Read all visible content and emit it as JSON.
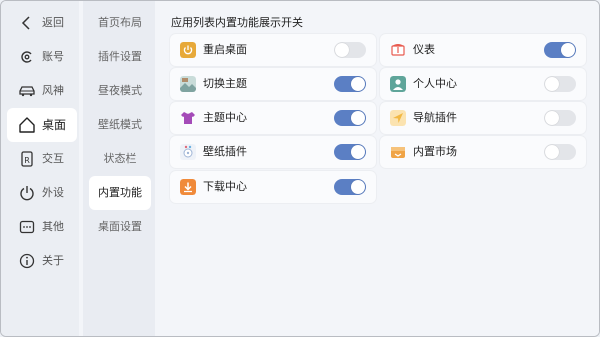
{
  "colors": {
    "toggle_on": "#5b7fc4",
    "toggle_off": "#e3e5e9",
    "active_bg": "#ffffff"
  },
  "nav": {
    "items": [
      {
        "label": "返回",
        "icon": "back-icon",
        "active": false
      },
      {
        "label": "账号",
        "icon": "account-icon",
        "active": false
      },
      {
        "label": "风神",
        "icon": "car-icon",
        "active": false
      },
      {
        "label": "桌面",
        "icon": "home-icon",
        "active": true
      },
      {
        "label": "交互",
        "icon": "interaction-icon",
        "active": false
      },
      {
        "label": "外设",
        "icon": "power-icon",
        "active": false
      },
      {
        "label": "其他",
        "icon": "more-icon",
        "active": false
      },
      {
        "label": "关于",
        "icon": "info-icon",
        "active": false
      }
    ]
  },
  "submenu": {
    "items": [
      {
        "label": "首页布局",
        "active": false
      },
      {
        "label": "插件设置",
        "active": false
      },
      {
        "label": "昼夜模式",
        "active": false
      },
      {
        "label": "壁纸模式",
        "active": false
      },
      {
        "label": "状态栏",
        "active": false
      },
      {
        "label": "内置功能",
        "active": true
      },
      {
        "label": "桌面设置",
        "active": false
      }
    ]
  },
  "main": {
    "title": "应用列表内置功能展示开关",
    "apps": [
      {
        "name": "重启桌面",
        "icon": "restart-icon",
        "icon_color": "#e7a93a",
        "on": false
      },
      {
        "name": "仪表",
        "icon": "dashboard-icon",
        "icon_color": "#e85a4f",
        "on": true
      },
      {
        "name": "切换主题",
        "icon": "theme-switch-icon",
        "icon_color": "#7fa3a0",
        "on": true
      },
      {
        "name": "个人中心",
        "icon": "profile-icon",
        "icon_color": "#5fa59a",
        "on": false
      },
      {
        "name": "主题中心",
        "icon": "theme-center-icon",
        "icon_color": "#a44bb8",
        "on": true
      },
      {
        "name": "导航插件",
        "icon": "navigation-icon",
        "icon_color": "#f2b843",
        "on": false
      },
      {
        "name": "壁纸插件",
        "icon": "wallpaper-icon",
        "icon_color": "#9fb5d6",
        "on": true
      },
      {
        "name": "内置市场",
        "icon": "market-icon",
        "icon_color": "#f0a446",
        "on": false
      },
      {
        "name": "下载中心",
        "icon": "download-icon",
        "icon_color": "#f08a3a",
        "on": true
      }
    ]
  }
}
